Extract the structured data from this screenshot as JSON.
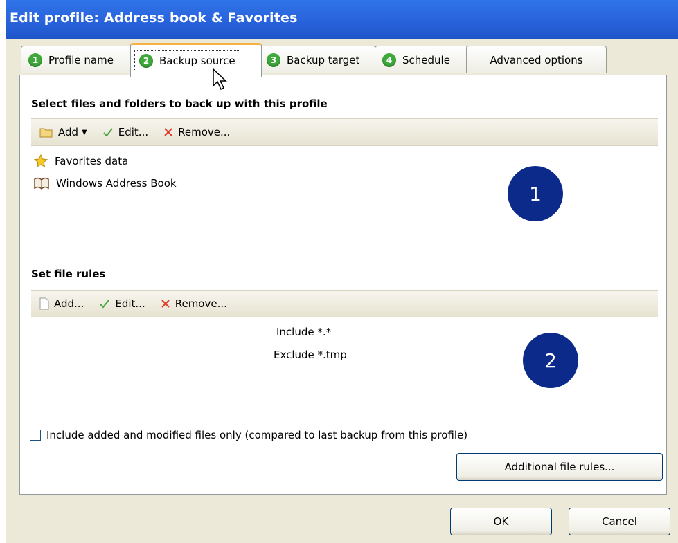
{
  "window": {
    "title": "Edit profile: Address book & Favorites"
  },
  "tabs": [
    {
      "number": "1",
      "label": "Profile name"
    },
    {
      "number": "2",
      "label": "Backup source"
    },
    {
      "number": "3",
      "label": "Backup target"
    },
    {
      "number": "4",
      "label": "Schedule"
    },
    {
      "number": "",
      "label": "Advanced options"
    }
  ],
  "source_section": {
    "title": "Select files and folders to back up with this profile",
    "toolbar": {
      "add": "Add",
      "edit": "Edit...",
      "remove": "Remove..."
    },
    "items": [
      {
        "label": "Favorites data",
        "icon": "star-icon"
      },
      {
        "label": "Windows Address Book",
        "icon": "address-book-icon"
      }
    ],
    "marker": "1"
  },
  "rules_section": {
    "title": "Set file rules",
    "toolbar": {
      "add": "Add...",
      "edit": "Edit...",
      "remove": "Remove..."
    },
    "rules": [
      "Include *.*",
      "Exclude *.tmp"
    ],
    "marker": "2"
  },
  "checkbox": {
    "label": "Include added and modified files only (compared to last backup from this profile)",
    "checked": false
  },
  "buttons": {
    "additional": "Additional file rules...",
    "ok": "OK",
    "cancel": "Cancel"
  },
  "colors": {
    "titlebar": "#2a66df",
    "marker": "#0b2a8a",
    "tab_number": "#3ea83a",
    "active_tab_accent": "#f4b341"
  }
}
